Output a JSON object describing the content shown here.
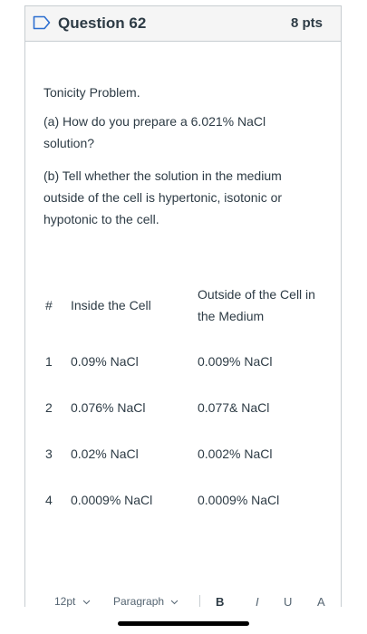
{
  "question": {
    "title": "Question 62",
    "points": "8 pts"
  },
  "body": {
    "intro": "Tonicity Problem.",
    "part_a": "(a) How do you prepare a 6.021% NaCl solution?",
    "part_b": "(b) Tell whether the solution in the medium outside of the cell is hypertonic, isotonic or hypotonic to the cell."
  },
  "table": {
    "headers": {
      "num": "#",
      "inside": "Inside the Cell",
      "outside": "Outside of the Cell in the Medium"
    },
    "rows": [
      {
        "num": "1",
        "inside": "0.09% NaCl",
        "outside": "0.009% NaCl"
      },
      {
        "num": "2",
        "inside": "0.076% NaCl",
        "outside": "0.077& NaCl"
      },
      {
        "num": "3",
        "inside": "0.02% NaCl",
        "outside": "0.002% NaCl"
      },
      {
        "num": "4",
        "inside": "0.0009% NaCl",
        "outside": "0.0009% NaCl"
      }
    ]
  },
  "toolbar": {
    "font_size": "12pt",
    "block_format": "Paragraph",
    "bold": "B",
    "italic": "I",
    "underline": "U",
    "text_color": "A"
  },
  "icons": {
    "flag": "flag-icon",
    "dropdown": "chevron-down-icon"
  },
  "colors": {
    "text": "#2d3b45",
    "header_bg": "#f5f5f5",
    "border": "#c7cdd1",
    "flag": "#2d6fd0"
  }
}
